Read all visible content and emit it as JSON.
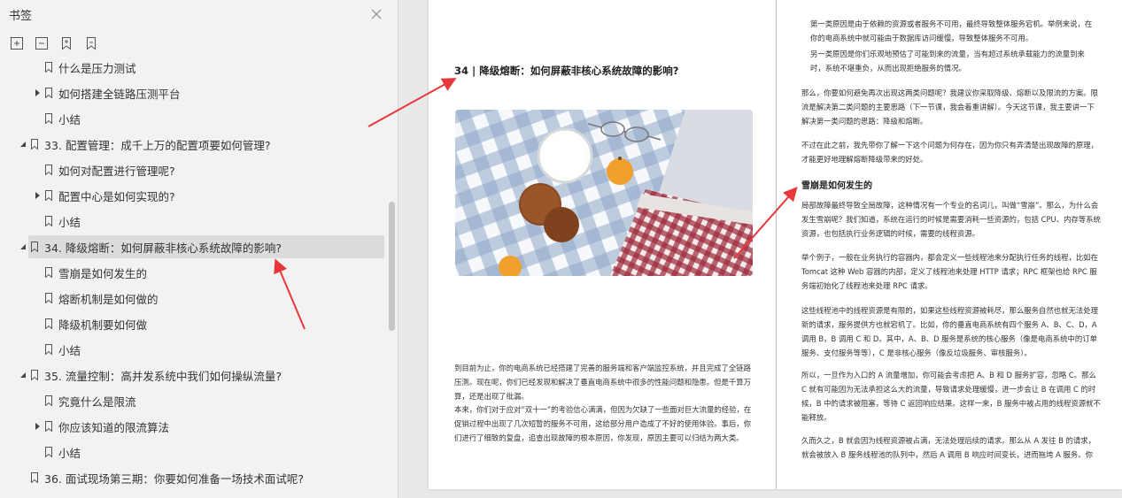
{
  "sidebar": {
    "title": "书签",
    "tools": [
      "expand-all",
      "collapse-all",
      "add-bookmark",
      "bookmark-options"
    ],
    "items": [
      {
        "label": "什么是压力测试",
        "level": 2,
        "expand": "none"
      },
      {
        "label": "如何搭建全链路压测平台",
        "level": 2,
        "expand": "collapsed"
      },
      {
        "label": "小结",
        "level": 2,
        "expand": "none"
      },
      {
        "label": "33. 配置管理：成千上万的配置项要如何管理?",
        "level": 1,
        "expand": "expanded"
      },
      {
        "label": "如何对配置进行管理呢?",
        "level": 2,
        "expand": "none"
      },
      {
        "label": "配置中心是如何实现的?",
        "level": 2,
        "expand": "collapsed"
      },
      {
        "label": "小结",
        "level": 2,
        "expand": "none"
      },
      {
        "label": "34. 降级熔断：如何屏蔽非核心系统故障的影响?",
        "level": 1,
        "expand": "expanded",
        "selected": true
      },
      {
        "label": "雪崩是如何发生的",
        "level": 2,
        "expand": "none"
      },
      {
        "label": "熔断机制是如何做的",
        "level": 2,
        "expand": "none"
      },
      {
        "label": "降级机制要如何做",
        "level": 2,
        "expand": "none"
      },
      {
        "label": "小结",
        "level": 2,
        "expand": "none"
      },
      {
        "label": "35. 流量控制：高并发系统中我们如何操纵流量?",
        "level": 1,
        "expand": "expanded"
      },
      {
        "label": "究竟什么是限流",
        "level": 2,
        "expand": "none"
      },
      {
        "label": "你应该知道的限流算法",
        "level": 2,
        "expand": "collapsed"
      },
      {
        "label": "小结",
        "level": 2,
        "expand": "none"
      },
      {
        "label": "36. 面试现场第三期：你要如何准备一场技术面试呢?",
        "level": 1,
        "expand": "none"
      }
    ]
  },
  "doc": {
    "title": "34 | 降级熔断：如何屏蔽非核心系统故障的影响?",
    "left_paras": [
      "到目前为止，你的电商系统已经搭建了完善的服务端和客户端监控系统，并且完成了全链路压测。现在呢，你们已经发现和解决了垂直电商系统中很多的性能问题和隐患。但是千算万算，还是出现了纰漏。",
      "本来，你们对于应对“双十一”的考验信心满满，但因为欠缺了一些面对巨大流量的经验，在促销过程中出现了几次短暂的服务不可用，这给部分用户造成了不好的使用体验。事后，你们进行了细致的复盘，追查出现故障的根本原因，你发现，原因主要可以归结为两大类。"
    ],
    "right_block1": [
      "第一类原因是由于依赖的资源或者服务不可用，最终导致整体服务宕机。举例来说，在你的电商系统中就可能由于数据库访问缓慢，导致整体服务不可用。",
      "另一类原因是你们乐观地预估了可能到来的流量，当有超过系统承载能力的流量到来时，系统不堪重负，从而出现拒绝服务的情况。"
    ],
    "right_block2": [
      "那么，你要如何避免再次出现这两类问题呢？我建议你采取降级、熔断以及限流的方案。限流是解决第二类问题的主要思路（下一节课，我会着重讲解）。今天这节课，我主要讲一下解决第一类问题的思路：降级和熔断。",
      "不过在此之前，我先带你了解一下这个问题为何存在，因为你只有弄清楚出现故障的原理，才能更好地理解熔断降级带来的好处。"
    ],
    "section_heading": "雪崩是如何发生的",
    "right_block3": [
      "局部故障最终导致全局故障，这种情况有一个专业的名词儿，叫做“雪崩”。那么，为什么会发生雪崩呢？我们知道，系统在运行的时候是需要消耗一些资源的，包括 CPU、内存等系统资源，也包括执行业务逻辑的时候，需要的线程资源。",
      "举个例子，一般在业务执行的容器内，都会定义一些线程池来分配执行任务的线程，比如在 Tomcat 这种 Web 容器的内部，定义了线程池来处理 HTTP 请求；RPC 框架也给 RPC 服务端初始化了线程池来处理 RPC 请求。",
      "这些线程池中的线程资源是有限的，如果这些线程资源被耗尽，那么服务自然也就无法处理新的请求，服务提供方也就宕机了。比如，你的垂直电商系统有四个服务 A、B、C、D，A 调用 B，B 调用 C 和 D。其中，A、B、D 服务是系统的核心服务（像是电商系统中的订单服务、支付服务等等），C 是非核心服务（像反垃圾服务、审核服务）。",
      "所以，一旦作为入口的 A 流量增加，你可能会考虑把 A、B 和 D 服务扩容，忽略 C。那么 C 就有可能因为无法承担这么大的流量，导致请求处理缓慢，进一步会让 B 在调用 C 的时候，B 中的请求被阻塞，等待 C 返回响应结果。这样一来，B 服务中被占用的线程资源就不能释放。",
      "久而久之，B 就会因为线程资源被占满，无法处理后续的请求。那么从 A 发往 B 的请求，就会被放入 B 服务线程池的队列中，然后 A 调用 B 响应时间变长，进而拖垮 A 服务。你"
    ]
  },
  "colors": {
    "arrow": "#e8373a",
    "selected_row": "#dcdcdc",
    "sidebar_bg": "#f2f2f2"
  }
}
